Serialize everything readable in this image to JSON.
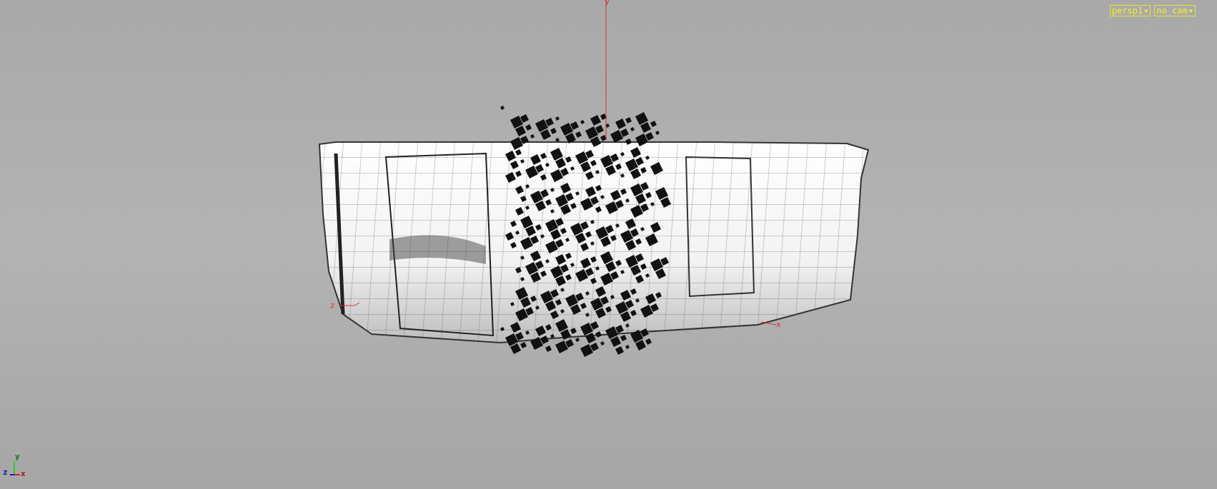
{
  "viewport": {
    "camera_menus": [
      {
        "label": "persp1",
        "caret": "▾"
      },
      {
        "label": "no cam",
        "caret": "▾"
      }
    ],
    "world_axes": [
      {
        "label": "y"
      },
      {
        "label": "z"
      },
      {
        "label": "x"
      }
    ],
    "orientation_gizmo": {
      "labels": [
        "y",
        "z",
        "x"
      ]
    }
  }
}
